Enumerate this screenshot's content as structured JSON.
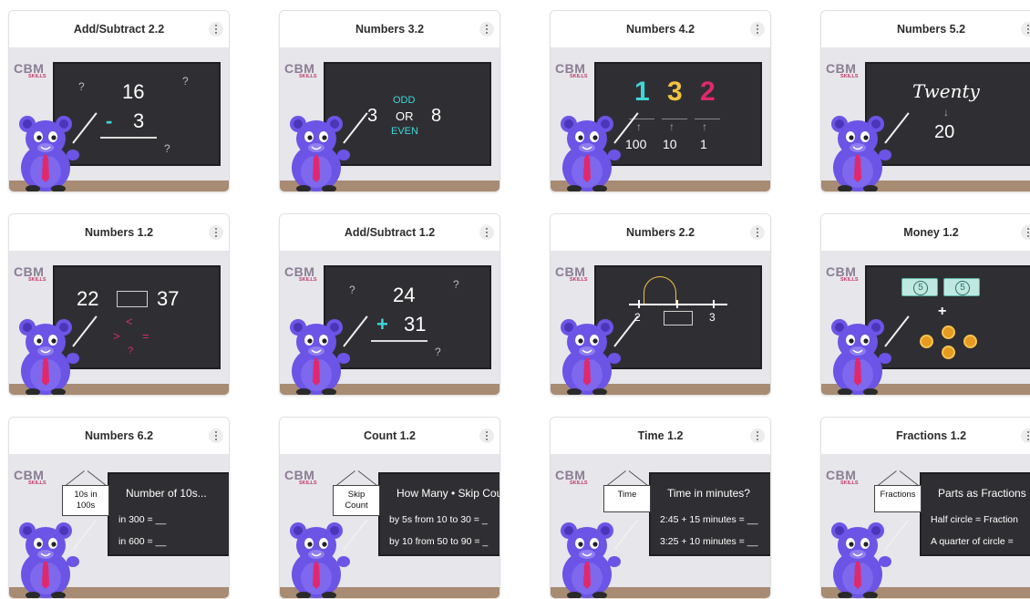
{
  "cards": [
    {
      "id": "add-subtract-2-2",
      "title": "Add/Subtract 2.2",
      "board": {
        "top": "16",
        "op": "-",
        "bottom": "3",
        "marks": [
          "?",
          "?",
          "?"
        ]
      }
    },
    {
      "id": "numbers-3-2",
      "title": "Numbers 3.2",
      "board": {
        "left": "3",
        "right": "8",
        "words": [
          "ODD",
          "OR",
          "EVEN"
        ]
      }
    },
    {
      "id": "numbers-4-2",
      "title": "Numbers 4.2",
      "board": {
        "digits": [
          "1",
          "3",
          "2"
        ],
        "places": [
          "100",
          "10",
          "1"
        ]
      }
    },
    {
      "id": "numbers-5-2",
      "title": "Numbers 5.2",
      "board": {
        "word": "Twenty",
        "number": "20"
      }
    },
    {
      "id": "numbers-1-2",
      "title": "Numbers 1.2",
      "board": {
        "left": "22",
        "right": "37",
        "symbols": [
          "<",
          ">",
          "=",
          "?"
        ]
      }
    },
    {
      "id": "add-subtract-1-2",
      "title": "Add/Subtract 1.2",
      "board": {
        "top": "24",
        "op": "+",
        "bottom": "31",
        "marks": [
          "?",
          "?",
          "?"
        ]
      }
    },
    {
      "id": "numbers-2-2",
      "title": "Numbers 2.2",
      "board": {
        "left": "2",
        "right": "3"
      }
    },
    {
      "id": "money-1-2",
      "title": "Money 1.2",
      "board": {
        "bill": "5",
        "plus": "+"
      }
    },
    {
      "id": "numbers-6-2",
      "title": "Numbers 6.2",
      "sign": "10s in 100s",
      "board": {
        "heading": "Number of 10s...",
        "lines": [
          "in 300 = __",
          "in 600 = __"
        ]
      }
    },
    {
      "id": "count-1-2",
      "title": "Count 1.2",
      "sign": "Skip Count",
      "board": {
        "heading": "How Many • Skip Count",
        "lines": [
          "by 5s from 10 to 30 = _",
          "by 10 from 50 to 90 = _"
        ]
      }
    },
    {
      "id": "time-1-2",
      "title": "Time 1.2",
      "sign": "Time",
      "board": {
        "heading": "Time in minutes?",
        "lines": [
          "2:45 + 15 minutes = __",
          "3:25 + 10 minutes = __"
        ]
      }
    },
    {
      "id": "fractions-1-2",
      "title": "Fractions 1.2",
      "sign": "Fractions",
      "board": {
        "heading": "Parts as Fractions",
        "lines": [
          "Half circle = Fraction",
          "A quarter of circle ="
        ]
      }
    }
  ],
  "logo": {
    "big": "CBM",
    "small": "SKILLS"
  },
  "colors": {
    "bear": "#6b54e6",
    "bear_dark": "#4a36b8",
    "tie": "#e0296c",
    "board": "#2f2f33",
    "floor": "#a88b73",
    "accent_cyan": "#3fd6d9",
    "accent_pink": "#e0296c",
    "accent_yellow": "#f3c340"
  }
}
